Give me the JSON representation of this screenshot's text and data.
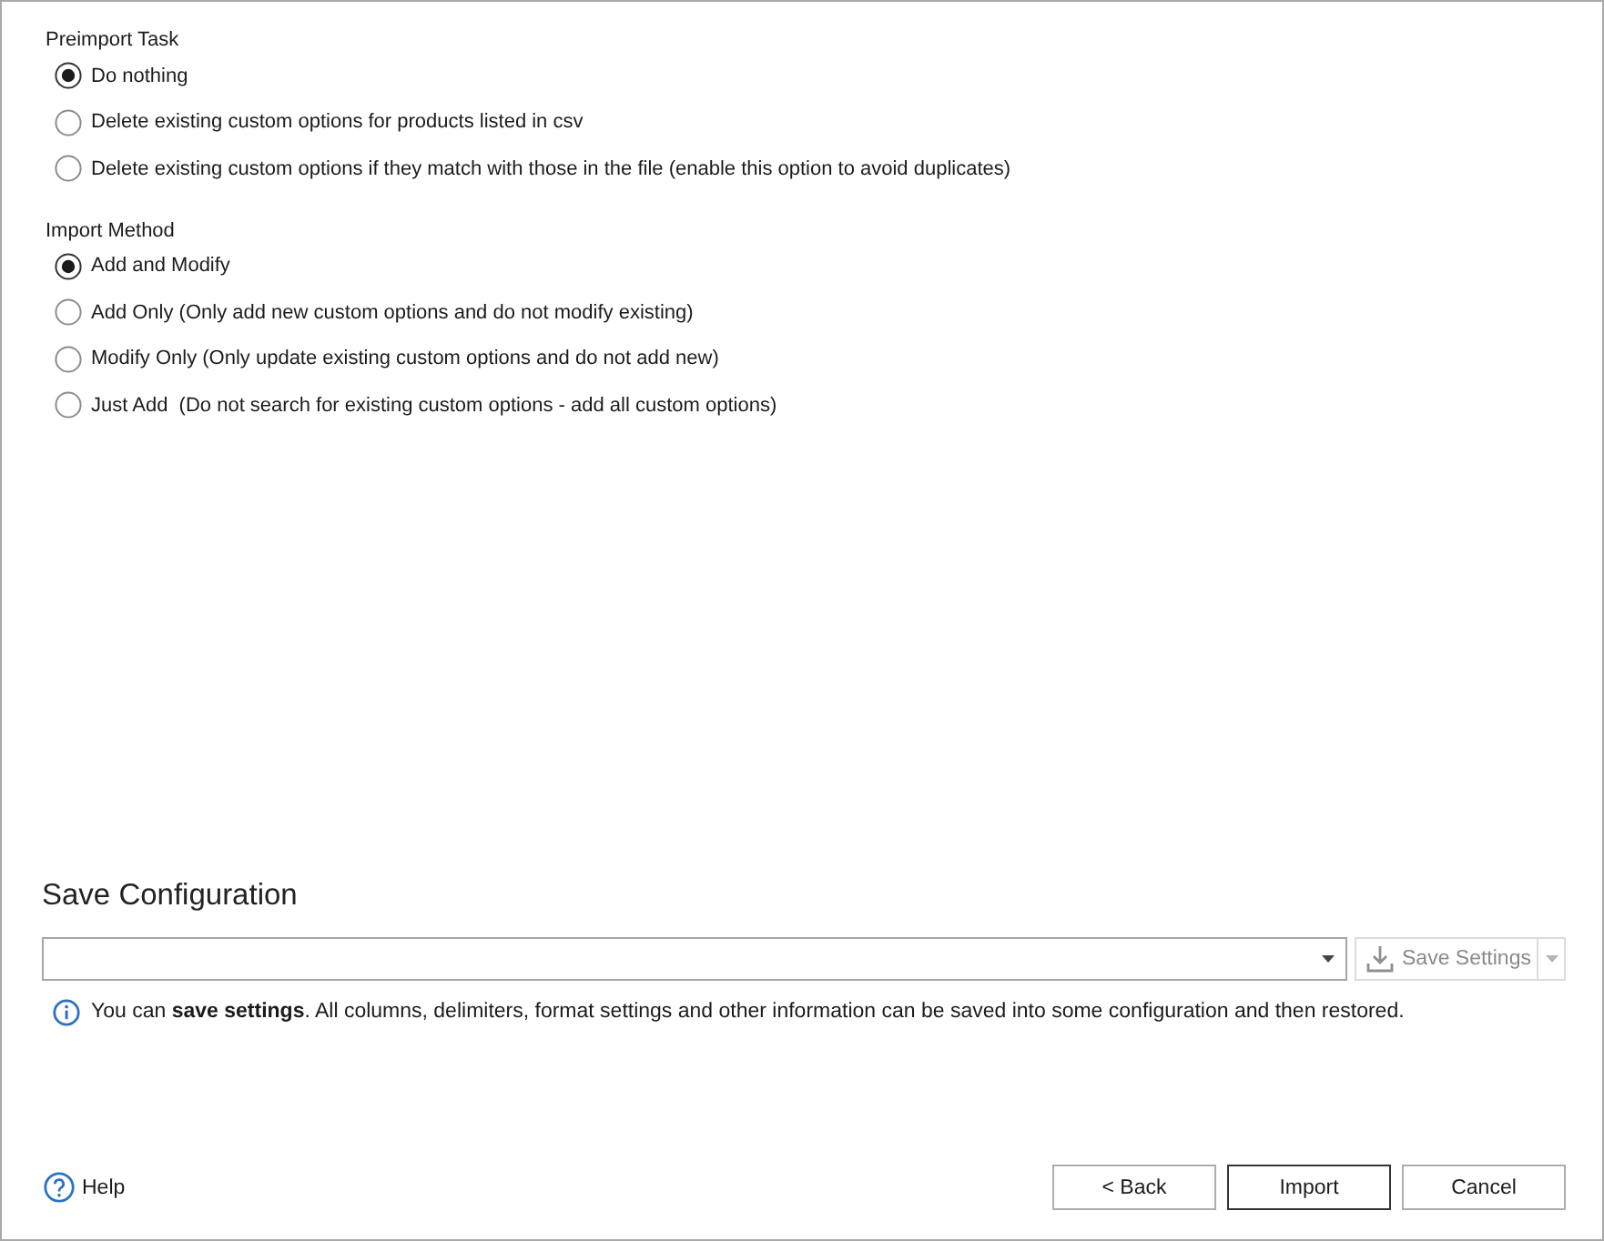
{
  "groups": [
    {
      "title": "Preimport Task",
      "options": [
        {
          "label": "Do nothing",
          "selected": true
        },
        {
          "label": "Delete existing custom options for products listed in csv",
          "selected": false
        },
        {
          "label": "Delete existing custom options if they match with those in the file (enable this option to avoid duplicates)",
          "selected": false
        }
      ]
    },
    {
      "title": "Import Method",
      "options": [
        {
          "label": "Add and Modify",
          "selected": true
        },
        {
          "label": "Add Only (Only add new custom options and do not modify existing)",
          "selected": false
        },
        {
          "label": "Modify Only (Only update existing custom options and do not add new)",
          "selected": false
        },
        {
          "label": "Just Add  (Do not search for existing custom options - add all custom options)",
          "selected": false
        }
      ]
    }
  ],
  "save_configuration": {
    "title": "Save Configuration",
    "save_button": {
      "label": "Save Settings",
      "disabled": true
    },
    "info": "You can **save settings**. All columns, delimiters, format settings and other information can be saved into some configuration and then restored."
  },
  "footer": {
    "help": "Help",
    "buttons": [
      {
        "label": "< Back",
        "default": false
      },
      {
        "label": "Import",
        "default": true
      },
      {
        "label": "Cancel",
        "default": false
      }
    ]
  }
}
